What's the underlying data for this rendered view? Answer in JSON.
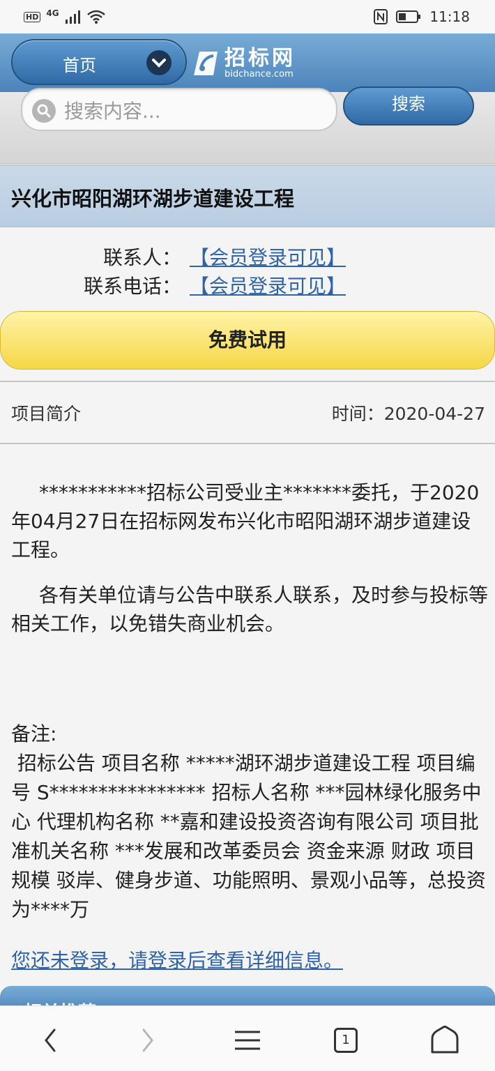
{
  "status_bar": {
    "network": "4G",
    "time": "11:18"
  },
  "header": {
    "home_label": "首页",
    "logo_text": "招标网",
    "logo_sub": "bidchance.com"
  },
  "search": {
    "placeholder": "搜索内容...",
    "button_label": "搜索"
  },
  "project": {
    "title": "兴化市昭阳湖环湖步道建设工程",
    "contact_label": "联系人：",
    "contact_value": "【会员登录可见】",
    "phone_label": "联系电话：",
    "phone_value": "【会员登录可见】",
    "trial_label": "免费试用",
    "intro_label": "项目简介",
    "date": "时间：2020-04-27",
    "para1": "***********招标公司受业主*******委托，于2020年04月27日在招标网发布兴化市昭阳湖环湖步道建设工程。",
    "para2": "各有关单位请与公告中联系人联系，及时参与投标等相关工作，以免错失商业机会。",
    "notes_label": "备注:",
    "notes_text": " 招标公告 项目名称 *****湖环湖步道建设工程 项目编号 S**************** 招标人名称 ***园林绿化服务中心 代理机构名称 **嘉和建设投资咨询有限公司 项目批准机关名称 ***发展和改革委员会 资金来源 财政 项目规模 驳岸、健身步道、功能照明、景观小品等，总投资为****万",
    "login_link": "您还未登录，请登录后查看详细信息。",
    "related_label": "相关推荐"
  },
  "nav_bar": {
    "tab_count": "1"
  },
  "colors": {
    "header_blue": "#4b84bb",
    "link_blue": "#2f63a8",
    "trial_yellow": "#f6d746"
  }
}
